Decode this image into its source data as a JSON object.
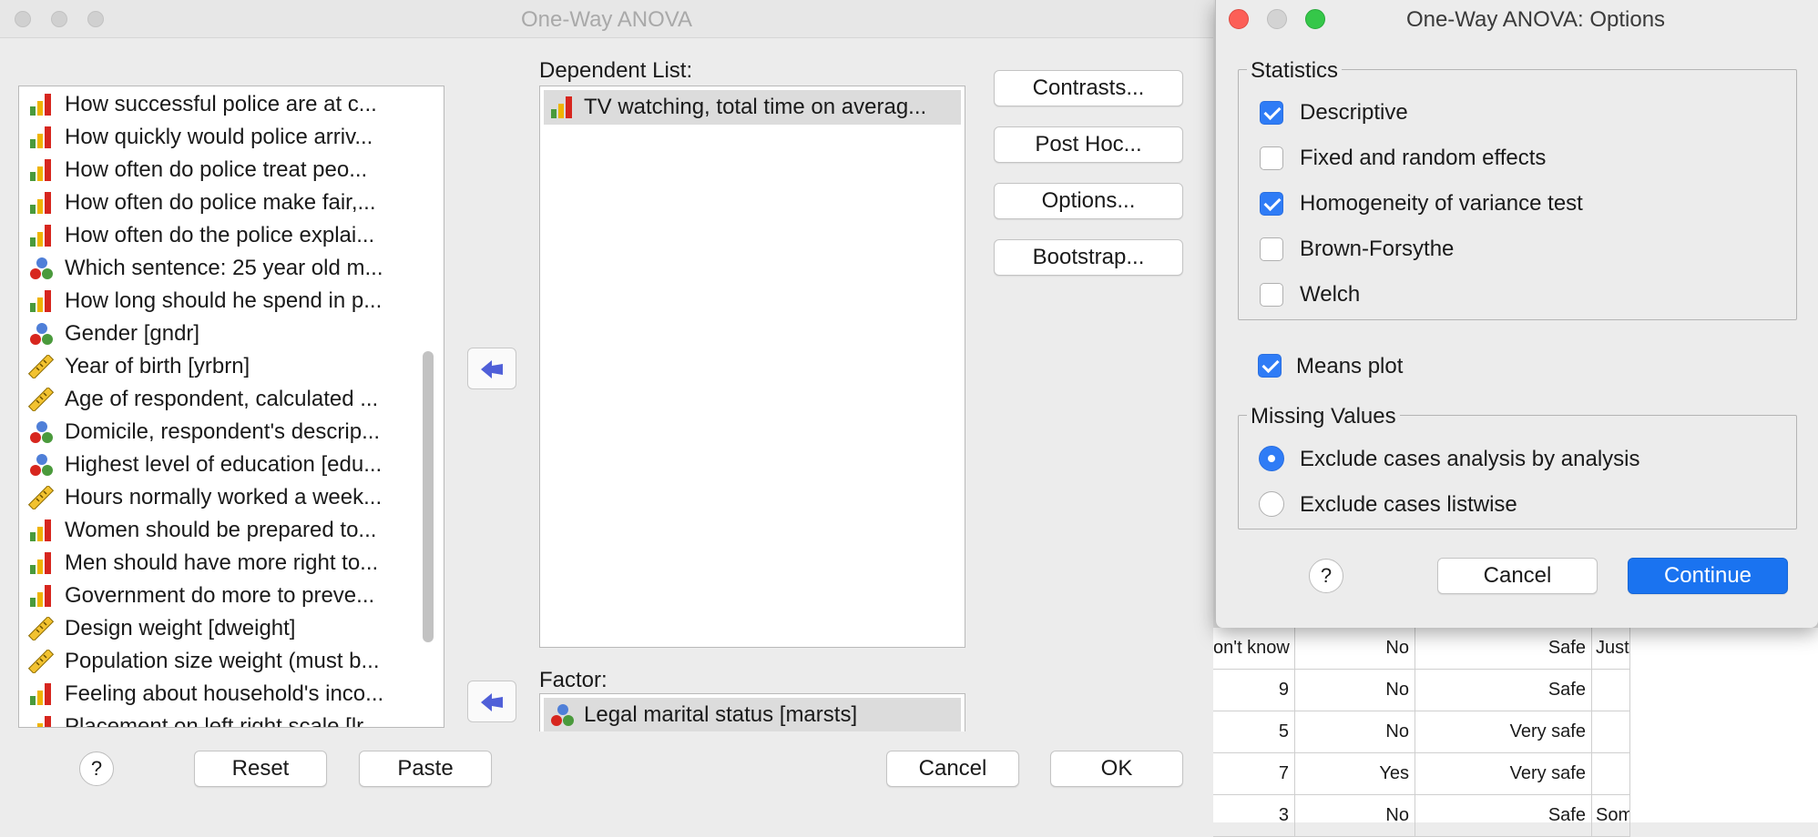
{
  "main_dialog": {
    "title": "One-Way ANOVA",
    "variables": [
      {
        "label": "How successful police are at c...",
        "icon": "ordinal-icon"
      },
      {
        "label": "How quickly would police arriv...",
        "icon": "ordinal-icon"
      },
      {
        "label": "How often do police treat peo...",
        "icon": "ordinal-icon"
      },
      {
        "label": "How often do police make fair,...",
        "icon": "ordinal-icon"
      },
      {
        "label": "How often do the police explai...",
        "icon": "ordinal-icon"
      },
      {
        "label": "Which sentence: 25 year old m...",
        "icon": "nominal-icon"
      },
      {
        "label": "How long should he spend in p...",
        "icon": "ordinal-icon"
      },
      {
        "label": "Gender [gndr]",
        "icon": "nominal-icon"
      },
      {
        "label": "Year of birth [yrbrn]",
        "icon": "scale-icon"
      },
      {
        "label": "Age of respondent, calculated ...",
        "icon": "scale-icon"
      },
      {
        "label": "Domicile, respondent's descrip...",
        "icon": "nominal-icon"
      },
      {
        "label": "Highest level of education [edu...",
        "icon": "nominal-icon"
      },
      {
        "label": "Hours normally worked a week...",
        "icon": "scale-icon"
      },
      {
        "label": "Women should be prepared to...",
        "icon": "ordinal-icon"
      },
      {
        "label": "Men should have more right to...",
        "icon": "ordinal-icon"
      },
      {
        "label": "Government do more to preve...",
        "icon": "ordinal-icon"
      },
      {
        "label": "Design weight [dweight]",
        "icon": "scale-icon"
      },
      {
        "label": "Population size weight (must b...",
        "icon": "scale-icon"
      },
      {
        "label": "Feeling about household's inco...",
        "icon": "ordinal-icon"
      },
      {
        "label": "Placement on left right scale [lr...",
        "icon": "ordinal-icon"
      }
    ],
    "dependent_list_label": "Dependent List:",
    "dependent_list": [
      "TV watching, total time on averag..."
    ],
    "factor_label": "Factor:",
    "factor": "Legal marital status [marsts]",
    "side_buttons": {
      "contrasts": "Contrasts...",
      "post_hoc": "Post Hoc...",
      "options": "Options...",
      "bootstrap": "Bootstrap..."
    },
    "bottom_buttons": {
      "help": "?",
      "reset": "Reset",
      "paste": "Paste",
      "cancel": "Cancel",
      "ok": "OK"
    }
  },
  "options_dialog": {
    "title": "One-Way ANOVA: Options",
    "statistics_label": "Statistics",
    "statistics": [
      {
        "label": "Descriptive",
        "checked": true
      },
      {
        "label": "Fixed and random effects",
        "checked": false
      },
      {
        "label": "Homogeneity of variance test",
        "checked": true
      },
      {
        "label": "Brown-Forsythe",
        "checked": false
      },
      {
        "label": "Welch",
        "checked": false
      }
    ],
    "means_plot": {
      "label": "Means plot",
      "checked": true
    },
    "missing_label": "Missing Values",
    "missing": [
      {
        "label": "Exclude cases analysis by analysis",
        "selected": true
      },
      {
        "label": "Exclude cases listwise",
        "selected": false
      }
    ],
    "buttons": {
      "help": "?",
      "cancel": "Cancel",
      "continue": "Continue"
    }
  },
  "background_grid": {
    "rows": [
      [
        "on't know",
        "No",
        "Safe",
        "Just"
      ],
      [
        "9",
        "No",
        "Safe",
        ""
      ],
      [
        "5",
        "No",
        "Very safe",
        ""
      ],
      [
        "7",
        "Yes",
        "Very safe",
        ""
      ],
      [
        "3",
        "No",
        "Safe",
        "Som"
      ]
    ]
  },
  "colors": {
    "accent": "#1a73f0",
    "checkbox_on": "#2f7cf6",
    "close": "#fc5f57",
    "zoom": "#35c749"
  }
}
